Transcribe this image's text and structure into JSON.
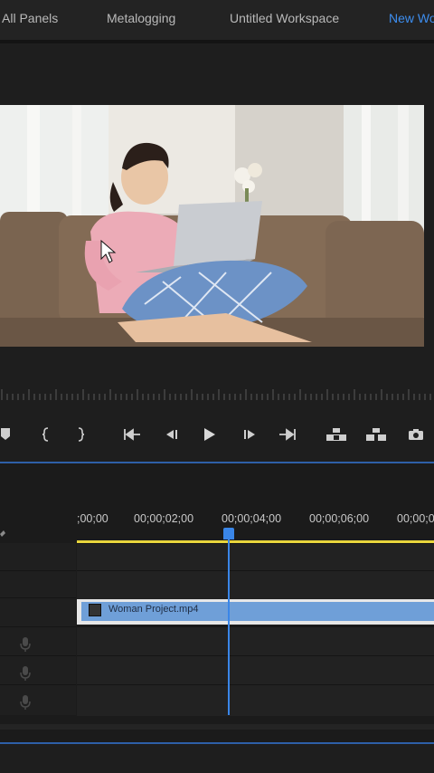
{
  "workspace_tabs": [
    "All Panels",
    "Metalogging",
    "Untitled Workspace",
    "New Wo"
  ],
  "active_tab_index": 3,
  "program_monitor": {
    "video_description_icon": "video-frame"
  },
  "transport": {
    "buttons": [
      "marker-icon",
      "mark-in-icon",
      "mark-out-icon",
      "go-to-in-icon",
      "step-back-icon",
      "play-icon",
      "step-forward-icon",
      "go-to-out-icon",
      "lift-icon",
      "extract-icon",
      "camera-icon"
    ]
  },
  "timeline": {
    "timecodes": [
      ";00;00",
      "00;00;02;00",
      "00;00;04;00",
      "00;00;06;00",
      "00;00;0"
    ],
    "clip_name": "Woman Project.mp4",
    "accent": "#3a86e8",
    "work_area_color": "#e8d53c",
    "clip_color": "#6f9fd8"
  }
}
